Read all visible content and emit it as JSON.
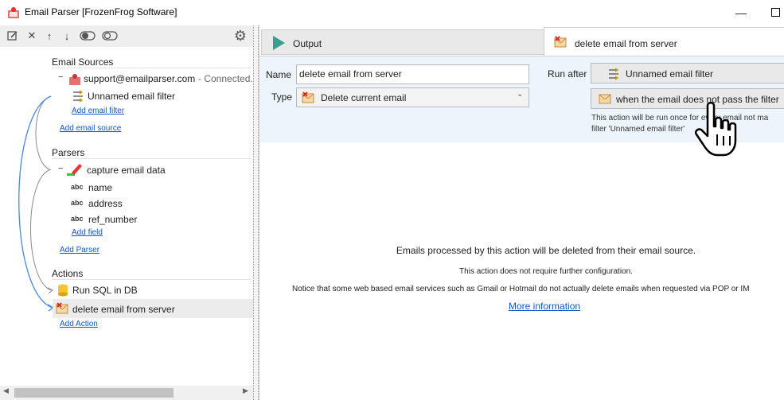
{
  "window": {
    "title": "Email Parser [FrozenFrog Software]",
    "minimize_glyph": "—"
  },
  "left_toolbar": {
    "icons": [
      "edit-icon",
      "delete-icon",
      "move-up-icon",
      "move-down-icon",
      "toggle-on-icon",
      "toggle-off-icon",
      "gear-icon"
    ]
  },
  "tree": {
    "email_sources": {
      "heading": "Email Sources",
      "source": {
        "name": "support@emailparser.com",
        "status": "- Connected."
      },
      "filter": "Unnamed email filter",
      "add_filter": "Add email filter",
      "add_source": "Add email source"
    },
    "parsers": {
      "heading": "Parsers",
      "parser": "capture email data",
      "fields": [
        {
          "type": "abc",
          "name": "name"
        },
        {
          "type": "abc",
          "name": "address"
        },
        {
          "type": "abc",
          "name": "ref_number"
        }
      ],
      "add_field": "Add field",
      "add_parser": "Add Parser"
    },
    "actions": {
      "heading": "Actions",
      "items": [
        "Run SQL in DB",
        "delete email from server"
      ],
      "add_action": "Add Action"
    }
  },
  "tabs": {
    "output": "Output",
    "active": "delete email from server"
  },
  "form": {
    "name_label": "Name",
    "name_value": "delete email from server",
    "type_label": "Type",
    "type_value": "Delete current email",
    "run_after_label": "Run after",
    "run_after_value": "Unnamed email filter",
    "condition_value": "when the email does not pass the filter",
    "condition_note_line1": "This action will be run once for every email not ma",
    "condition_note_line2": "filter 'Unnamed email filter'"
  },
  "body": {
    "line1": "Emails processed by this action will be deleted from their email source.",
    "line2": "This action does not require further configuration.",
    "line3": "Notice that some web based email services such as Gmail or Hotmail do not actually delete emails when requested via POP or IM",
    "more_info": "More information"
  },
  "colors": {
    "link": "#0b57d0",
    "config_bg": "#eef4fb",
    "play_icon": "#3a9e8f",
    "arrow_lines": "#4a86e8"
  }
}
